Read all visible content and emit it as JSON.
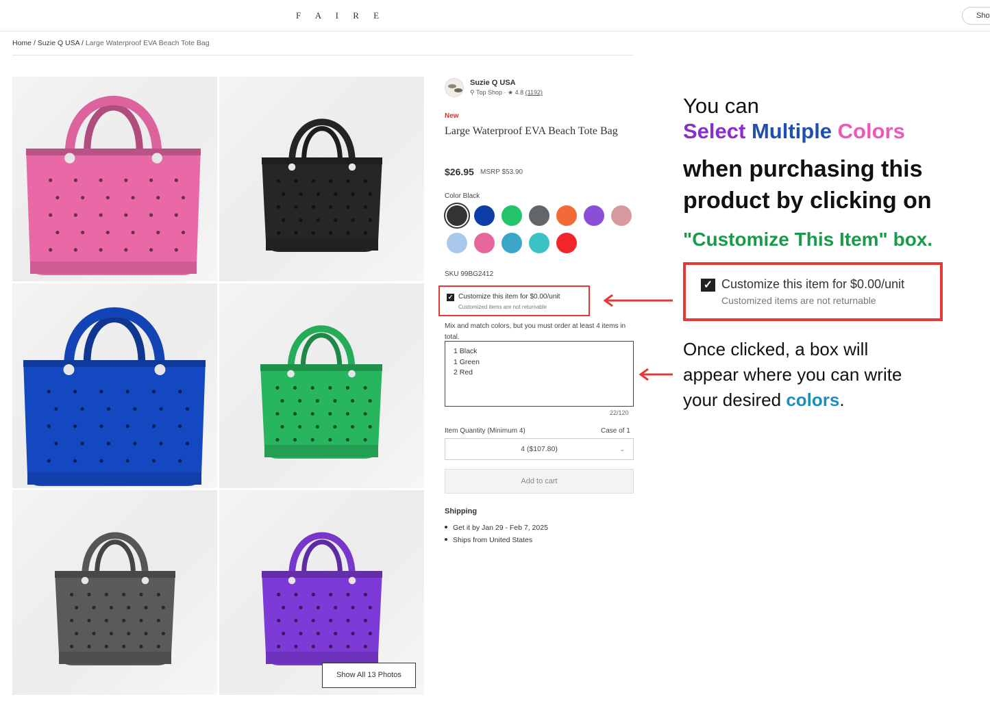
{
  "header": {
    "logo": "F A I R E",
    "shop_button": "Sho"
  },
  "breadcrumb": {
    "home": "Home",
    "brand": "Suzie Q USA",
    "current": "Large Waterproof EVA Beach Tote Bag"
  },
  "gallery": {
    "show_all": "Show All 13 Photos",
    "bag_colors": [
      "#e968a6",
      "#262626",
      "#1448c0",
      "#27b55e",
      "#5a5a5a",
      "#7d3ad6"
    ]
  },
  "product": {
    "shop_name": "Suzie Q USA",
    "shop_badge": "Top Shop",
    "rating": "4.8",
    "review_count": "(1192)",
    "new_badge": "New",
    "title": "Large Waterproof EVA Beach Tote Bag",
    "price": "$26.95",
    "msrp": "MSRP $53.90",
    "color_label": "Color Black",
    "swatches": [
      "#333333",
      "#0b3ea6",
      "#23c46a",
      "#636668",
      "#f26a37",
      "#8a4fd9",
      "#d69a9e",
      "#a9c8ea",
      "#e6689b",
      "#3aa6c9",
      "#3cc2c4",
      "#f1262a"
    ],
    "sku": "SKU 99BG2412",
    "customize_label": "Customize this item for $0.00/unit",
    "customize_sub": "Customized items are not returnable",
    "mix_text": "Mix and match colors, but you must order at least 4 items in total.",
    "note_lines": [
      "1 Black",
      "1 Green",
      "2 Red"
    ],
    "counter": "22/120",
    "qty_label": "Item Quantity (Minimum 4)",
    "case_label": "Case of 1",
    "qty_value": "4 ($107.80)",
    "add_to_cart": "Add to cart",
    "shipping_heading": "Shipping",
    "shipping_items": [
      "Get it by Jan 29 - Feb 7, 2025",
      "Ships from United States"
    ]
  },
  "annotation": {
    "line1": "You can",
    "line2_parts": [
      "Select ",
      "Multiple ",
      "Colors"
    ],
    "line2_colors": [
      "#8a2ecb",
      "#1f4fb0",
      "#e85ab6"
    ],
    "line3": "when purchasing this",
    "line4": "product by clicking on",
    "line5": "\"Customize This Item\" box.",
    "zoom_label": "Customize this item for $0.00/unit",
    "zoom_sub": "Customized items are not returnable",
    "line6": "Once clicked, a box will",
    "line7": "appear where you can write",
    "line8_pre": "your desired ",
    "line8_colored": "colors",
    "line8_post": ".",
    "accent_red": "#e53935",
    "accent_green": "#1a9a4b",
    "accent_teal": "#1a8fc0"
  }
}
